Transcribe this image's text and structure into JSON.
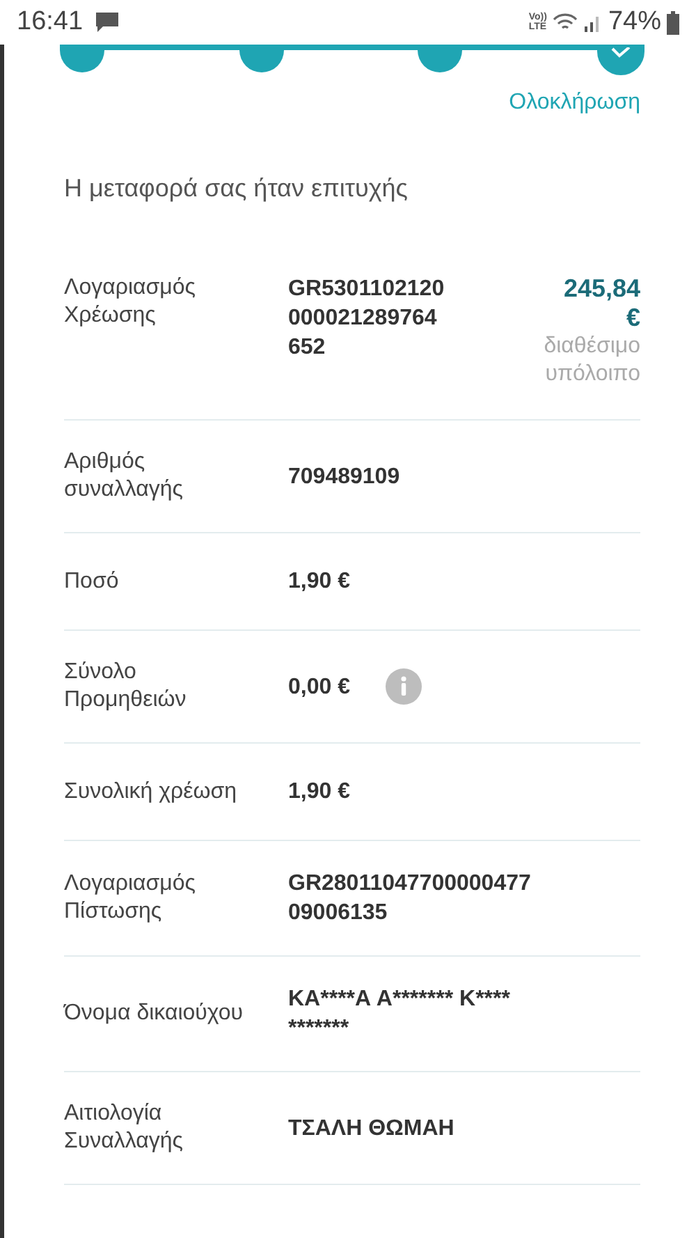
{
  "status_bar": {
    "time": "16:41",
    "network": "Vo))\nLTE",
    "battery": "74%"
  },
  "stepper": {
    "steps": [
      {
        "done": true,
        "current": false
      },
      {
        "done": true,
        "current": false
      },
      {
        "done": true,
        "current": false
      },
      {
        "done": true,
        "current": true
      }
    ],
    "current_label": "Ολοκλήρωση"
  },
  "title": "Η μεταφορά σας ήταν επιτυχής",
  "rows": [
    {
      "label": "Λογαριασμός Χρέωσης",
      "value": "GR5301102120000021289764652",
      "kind": "account",
      "balance": {
        "amount": "245,84 €",
        "caption": "διαθέσιμο υπόλοιπο"
      }
    },
    {
      "label": "Αριθμός συναλλαγής",
      "value": "709489109",
      "kind": "plain"
    },
    {
      "label": "Ποσό",
      "value": "1,90 €",
      "kind": "plain"
    },
    {
      "label": "Σύνολο Προμηθειών",
      "value": "0,00 €",
      "kind": "info"
    },
    {
      "label": "Συνολική χρέωση",
      "value": "1,90 €",
      "kind": "plain"
    },
    {
      "label": "Λογαριασμός Πίστωσης",
      "value": "GR2801104770000047709006135",
      "kind": "plain"
    },
    {
      "label": "Όνομα δικαιούχου",
      "value": "ΚΑ****Α Α******* Κ**** *******",
      "kind": "plain"
    },
    {
      "label": "Αιτιολογία Συναλλαγής",
      "value": "ΤΣΑΛΗ ΘΩΜΑΗ",
      "kind": "plain"
    }
  ]
}
